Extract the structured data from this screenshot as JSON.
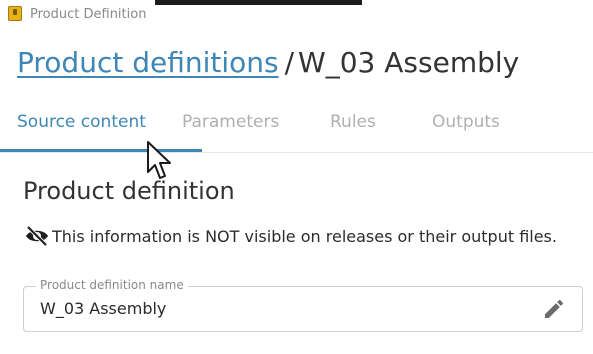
{
  "window": {
    "title": "Product Definition",
    "icon": "app-icon"
  },
  "header": {
    "breadcrumb_link": "Product definitions",
    "separator": "/",
    "current": "W_03 Assembly"
  },
  "tabs": [
    {
      "label": "Source content",
      "active": true
    },
    {
      "label": "Parameters",
      "active": false
    },
    {
      "label": "Rules",
      "active": false
    },
    {
      "label": "Outputs",
      "active": false
    }
  ],
  "section": {
    "title": "Product definition",
    "notice": "This information is NOT visible on releases or their output files.",
    "notice_icon": "eye-off-icon"
  },
  "field": {
    "label": "Product definition name",
    "value": "W_03 Assembly",
    "edit_icon": "pencil-icon"
  },
  "colors": {
    "accent": "#3e86b5",
    "tab_inactive": "#b0b0b0",
    "text": "#333333"
  }
}
